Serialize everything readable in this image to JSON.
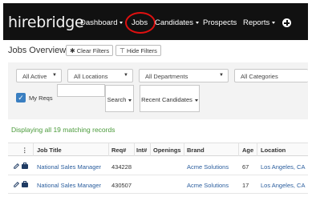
{
  "navbar": {
    "logo": "hirebridge",
    "items": [
      {
        "label": "Dashboard",
        "dropdown": true
      },
      {
        "label": "Jobs",
        "dropdown": false,
        "highlighted": true
      },
      {
        "label": "Candidates",
        "dropdown": true
      },
      {
        "label": "Prospects",
        "dropdown": false
      },
      {
        "label": "Reports",
        "dropdown": true
      }
    ],
    "add_icon": "plus-circle-icon",
    "highlight_color": "#e01010"
  },
  "page": {
    "title": "Jobs Overview",
    "clear_filters": "Clear Filters",
    "hide_filters": "Hide Filters"
  },
  "filters": {
    "status": "All Active",
    "location": "All Locations",
    "department": "All Departments",
    "category": "All Categories",
    "my_reqs_label": "My Reqs",
    "my_reqs_checked": true,
    "search_value": "",
    "search_button": "Search",
    "recent_candidates": "Recent Candidates"
  },
  "status_text": "Displaying all 19 matching records",
  "table": {
    "headers": [
      "⋮",
      "Job Title",
      "Req#",
      "Int#",
      "Openings",
      "Brand",
      "Age",
      "Location"
    ],
    "rows": [
      {
        "title": "National Sales Manager",
        "req": "434228",
        "int": "",
        "openings": "",
        "brand": "Acme Solutions",
        "age": "67",
        "location": "Los Angeles, CA"
      },
      {
        "title": "National Sales Manager",
        "req": "430507",
        "int": "",
        "openings": "",
        "brand": "Acme Solutions",
        "age": "17",
        "location": "Los Angeles, CA"
      }
    ]
  },
  "colors": {
    "navbar_bg": "#111111",
    "link": "#2b5e9e",
    "status": "#4a9a3a",
    "checkbox": "#3a7fc1"
  }
}
